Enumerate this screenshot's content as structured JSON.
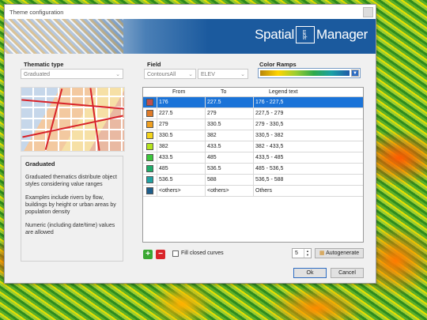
{
  "window": {
    "title": "Theme configuration"
  },
  "brand": {
    "left": "Spatial",
    "mark": "spm",
    "right": "Manager"
  },
  "thematic": {
    "label": "Thematic type",
    "value": "Graduated"
  },
  "field": {
    "label": "Field",
    "source": "ContoursAll",
    "name": "ELEV"
  },
  "color_ramps": {
    "label": "Color Ramps",
    "colors": [
      "#b8860b",
      "#ffd400",
      "#9acd32",
      "#2eaa4a",
      "#19a0a6",
      "#1e5aa8"
    ]
  },
  "description": {
    "heading": "Graduated",
    "p1": "Graduated thematics distribute object styles considering value ranges",
    "p2": "Examples include rivers by flow, buildings by height or urban areas by population density",
    "p3": "Numeric (including date/time) values are allowed"
  },
  "table": {
    "headers": {
      "from": "From",
      "to": "To",
      "legend": "Legend text"
    },
    "rows": [
      {
        "color": "#c0504d",
        "from": "176",
        "to": "227.5",
        "legend": "176 - 227,5",
        "selected": true
      },
      {
        "color": "#e07b27",
        "from": "227.5",
        "to": "279",
        "legend": "227,5 - 279"
      },
      {
        "color": "#f0a020",
        "from": "279",
        "to": "330.5",
        "legend": "279 - 330,5"
      },
      {
        "color": "#f5d51a",
        "from": "330.5",
        "to": "382",
        "legend": "330,5 - 382"
      },
      {
        "color": "#b5e51d",
        "from": "382",
        "to": "433.5",
        "legend": "382 - 433,5"
      },
      {
        "color": "#3cc83c",
        "from": "433.5",
        "to": "485",
        "legend": "433,5 - 485"
      },
      {
        "color": "#1fae6a",
        "from": "485",
        "to": "536.5",
        "legend": "485 - 536,5"
      },
      {
        "color": "#21a3a3",
        "from": "536.5",
        "to": "588",
        "legend": "536,5 - 588"
      },
      {
        "color": "#1e5f8c",
        "from": "<others>",
        "to": "<others>",
        "legend": "Others"
      }
    ]
  },
  "controls": {
    "fill_label": "Fill closed curves",
    "count": "5",
    "autogenerate": "Autogenerate",
    "ok": "Ok",
    "cancel": "Cancel"
  }
}
